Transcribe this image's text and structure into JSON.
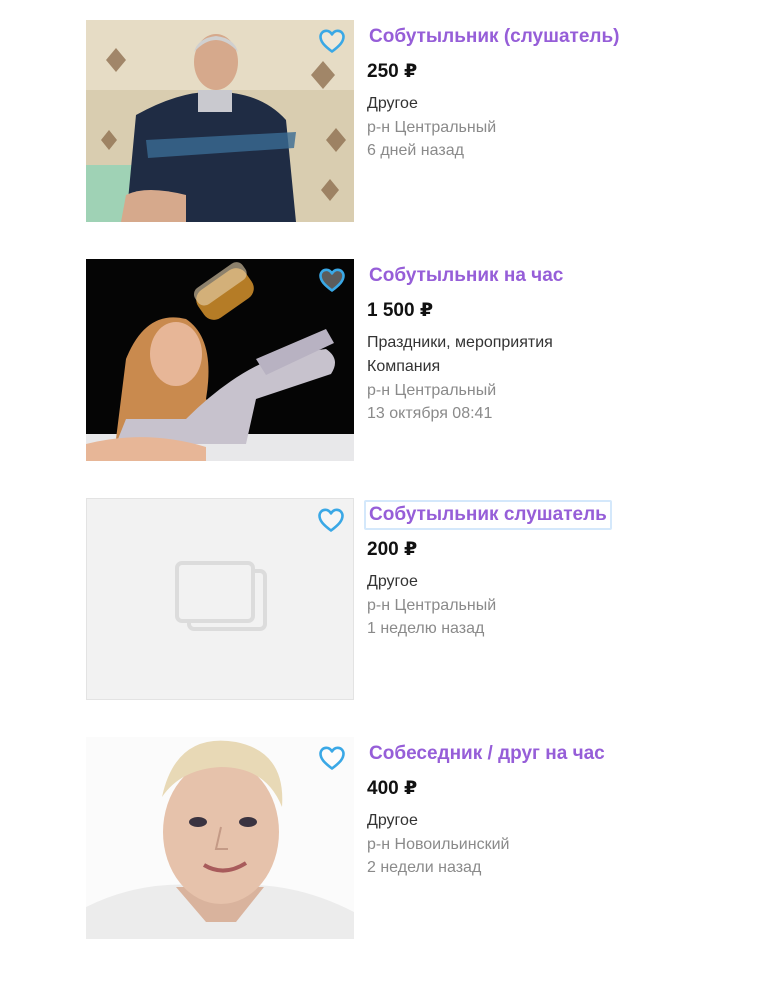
{
  "colors": {
    "title": "#965ed8",
    "price": "#111111",
    "meta": "#8a8a8a",
    "favorite": "#3aa8e6"
  },
  "listings": [
    {
      "title": "Собутыльник (слушатель)",
      "price": "250 ₽",
      "category": "Другое",
      "district": "р-н Центральный",
      "date": "6 дней назад",
      "image": "photo-man-on-sofa",
      "favorite_icon": "heart-outline-icon"
    },
    {
      "title": "Собутыльник на час",
      "price": "1 500 ₽",
      "category": "Праздники, мероприятия",
      "subcategory": "Компания",
      "district": "р-н Центральный",
      "date": "13 октября 08:41",
      "image": "photo-woman-drinking",
      "favorite_icon": "heart-outline-icon"
    },
    {
      "title": "Собутыльник слушатель",
      "price": "200 ₽",
      "category": "Другое",
      "district": "р-н Центральный",
      "date": "1 неделю назад",
      "image": "no-photo-placeholder",
      "favorite_icon": "heart-outline-icon"
    },
    {
      "title": "Собеседник / друг на час",
      "price": "400 ₽",
      "category": "Другое",
      "district": "р-н Новоильинский",
      "date": "2 недели назад",
      "image": "photo-young-man-selfie",
      "favorite_icon": "heart-outline-icon"
    }
  ]
}
